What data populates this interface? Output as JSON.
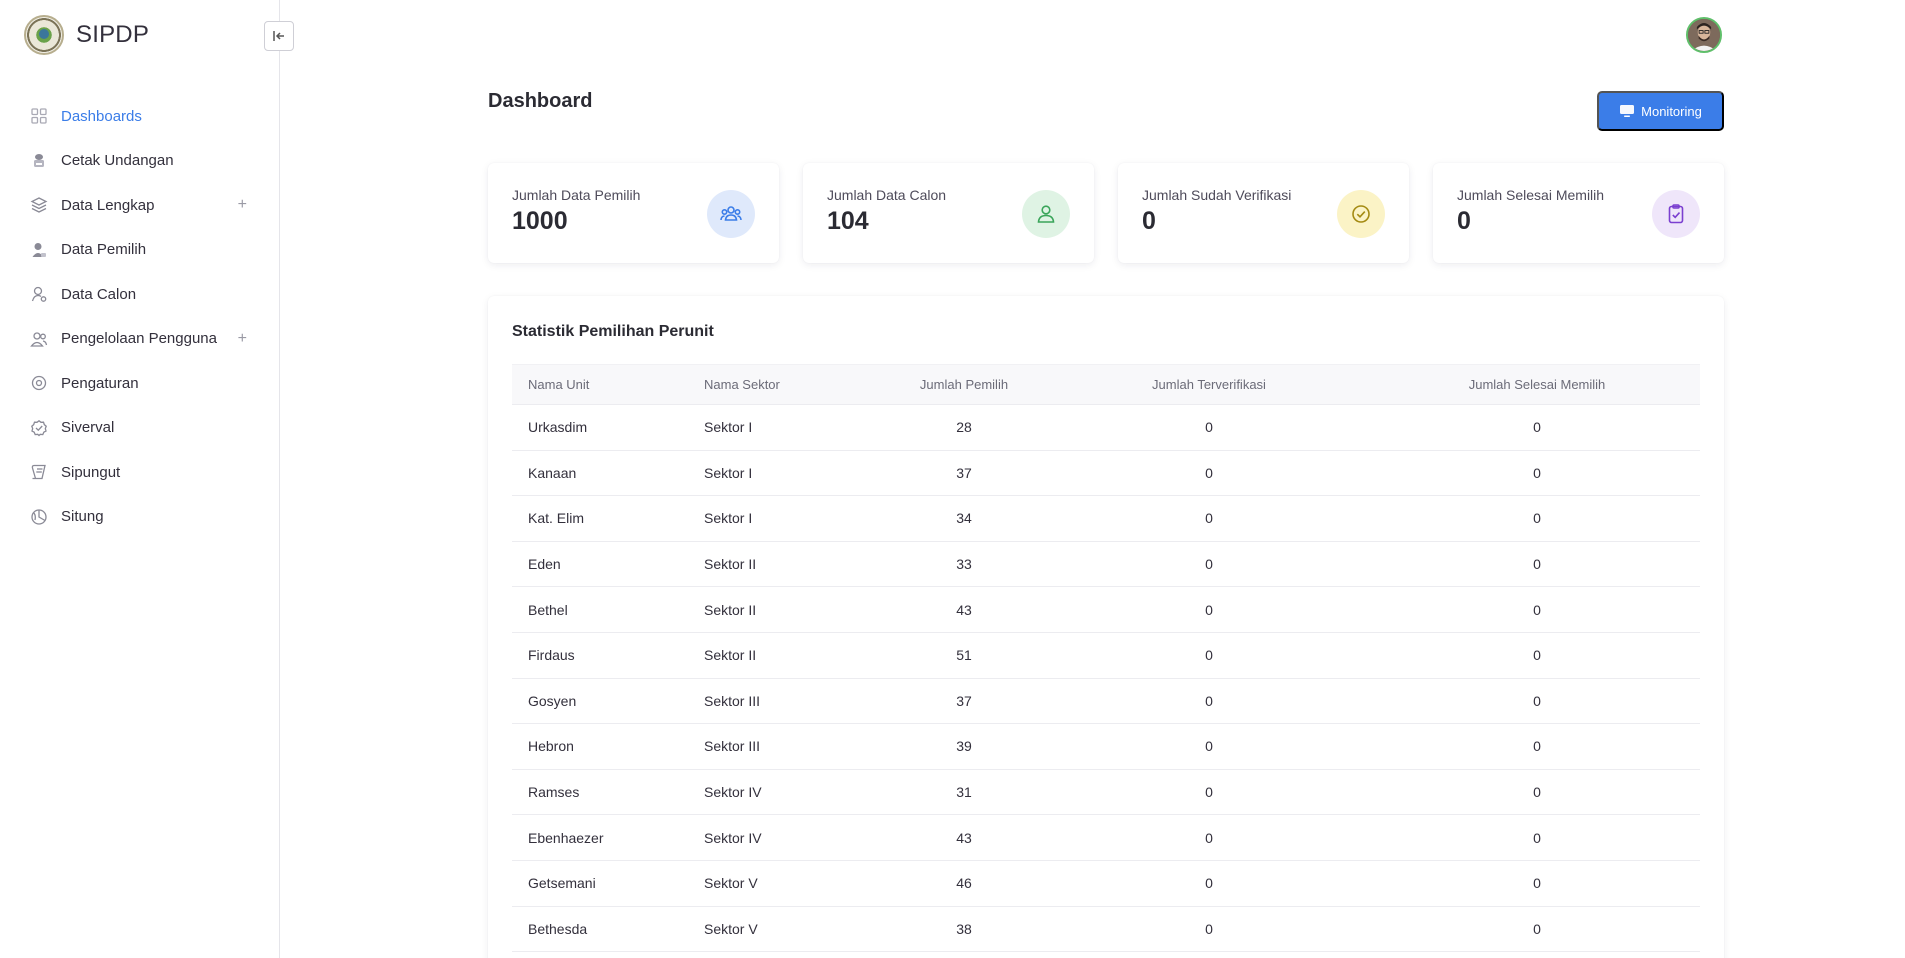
{
  "brand": {
    "name": "SIPDP"
  },
  "sidebar": {
    "items": [
      {
        "label": "Dashboards",
        "icon": "grid-icon",
        "active": true,
        "expandable": false
      },
      {
        "label": "Cetak Undangan",
        "icon": "printer-icon",
        "active": false,
        "expandable": false
      },
      {
        "label": "Data Lengkap",
        "icon": "layers-icon",
        "active": false,
        "expandable": true
      },
      {
        "label": "Data Pemilih",
        "icon": "user-icon",
        "active": false,
        "expandable": false
      },
      {
        "label": "Data Calon",
        "icon": "user-tie-icon",
        "active": false,
        "expandable": false
      },
      {
        "label": "Pengelolaan Pengguna",
        "icon": "users-icon",
        "active": false,
        "expandable": true
      },
      {
        "label": "Pengaturan",
        "icon": "settings-icon",
        "active": false,
        "expandable": false
      },
      {
        "label": "Siverval",
        "icon": "badge-check-icon",
        "active": false,
        "expandable": false
      },
      {
        "label": "Sipungut",
        "icon": "scroll-icon",
        "active": false,
        "expandable": false
      },
      {
        "label": "Situng",
        "icon": "pie-chart-icon",
        "active": false,
        "expandable": false
      }
    ]
  },
  "header": {
    "title": "Dashboard",
    "monitoring_label": "Monitoring"
  },
  "cards": [
    {
      "label": "Jumlah Data Pemilih",
      "value": "1000",
      "icon": "users-group-icon",
      "bg": "#dfe9fb",
      "fg": "#3b7de8"
    },
    {
      "label": "Jumlah Data Calon",
      "value": "104",
      "icon": "user-icon",
      "bg": "#dff3e4",
      "fg": "#3aa55a"
    },
    {
      "label": "Jumlah Sudah Verifikasi",
      "value": "0",
      "icon": "check-circle-icon",
      "bg": "#fbf3c6",
      "fg": "#a48a12"
    },
    {
      "label": "Jumlah Selesai Memilih",
      "value": "0",
      "icon": "clipboard-check-icon",
      "bg": "#efe6fa",
      "fg": "#7b3fd0"
    }
  ],
  "stats": {
    "title": "Statistik Pemilihan Perunit",
    "columns": [
      "Nama Unit",
      "Nama Sektor",
      "Jumlah Pemilih",
      "Jumlah Terverifikasi",
      "Jumlah Selesai Memilih"
    ],
    "rows": [
      [
        "Urkasdim",
        "Sektor I",
        "28",
        "0",
        "0"
      ],
      [
        "Kanaan",
        "Sektor I",
        "37",
        "0",
        "0"
      ],
      [
        "Kat. Elim",
        "Sektor I",
        "34",
        "0",
        "0"
      ],
      [
        "Eden",
        "Sektor II",
        "33",
        "0",
        "0"
      ],
      [
        "Bethel",
        "Sektor II",
        "43",
        "0",
        "0"
      ],
      [
        "Firdaus",
        "Sektor II",
        "51",
        "0",
        "0"
      ],
      [
        "Gosyen",
        "Sektor III",
        "37",
        "0",
        "0"
      ],
      [
        "Hebron",
        "Sektor III",
        "39",
        "0",
        "0"
      ],
      [
        "Ramses",
        "Sektor IV",
        "31",
        "0",
        "0"
      ],
      [
        "Ebenhaezer",
        "Sektor IV",
        "43",
        "0",
        "0"
      ],
      [
        "Getsemani",
        "Sektor V",
        "46",
        "0",
        "0"
      ],
      [
        "Bethesda",
        "Sektor V",
        "38",
        "0",
        "0"
      ]
    ]
  },
  "colors": {
    "accent": "#3b7de8",
    "sidebar_border": "#e5e5ea"
  }
}
